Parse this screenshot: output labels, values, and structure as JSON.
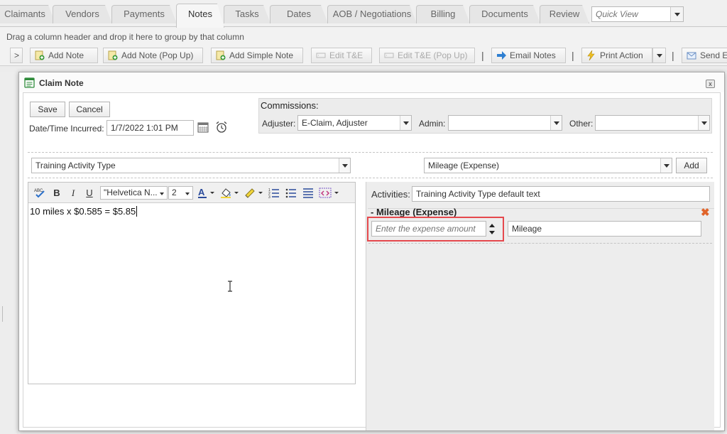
{
  "tabs": [
    {
      "label": "Claimants",
      "active": false
    },
    {
      "label": "Vendors",
      "active": false
    },
    {
      "label": "Payments",
      "active": false
    },
    {
      "label": "Notes",
      "active": true
    },
    {
      "label": "Tasks",
      "active": false
    },
    {
      "label": "Dates",
      "active": false
    },
    {
      "label": "AOB / Negotiations",
      "active": false
    },
    {
      "label": "Billing",
      "active": false
    },
    {
      "label": "Documents",
      "active": false
    },
    {
      "label": "Review",
      "active": false
    }
  ],
  "quick_view": {
    "placeholder": "Quick View"
  },
  "group_hint": "Drag a column header and drop it here to group by that column",
  "toolbar": {
    "expand": ">",
    "add_note": "Add Note",
    "add_note_popup": "Add Note (Pop Up)",
    "add_simple_note": "Add Simple Note",
    "edit_te": "Edit T&E",
    "edit_te_popup": "Edit T&E (Pop Up)",
    "separator": "|",
    "email_notes": "Email Notes",
    "print_action": "Print Action",
    "send_email": "Send E"
  },
  "modal": {
    "title": "Claim Note",
    "close": "x",
    "save": "Save",
    "cancel": "Cancel",
    "datetime_label": "Date/Time Incurred:",
    "datetime_value": "1/7/2022 1:01 PM",
    "commissions": {
      "title": "Commissions:",
      "adjuster_label": "Adjuster:",
      "adjuster_value": "E-Claim, Adjuster",
      "admin_label": "Admin:",
      "admin_value": "",
      "other_label": "Other:",
      "other_value": ""
    },
    "activity_type": "Training Activity Type",
    "expense_type": "Mileage (Expense)",
    "add_button": "Add",
    "editor": {
      "font_name": "\"Helvetica N...",
      "font_size": "2",
      "bold": "B",
      "italic": "I",
      "underline": "U",
      "content": "10 miles x $0.585 = $5.85"
    },
    "activities": {
      "label": "Activities:",
      "value": "Training Activity Type default text",
      "expense_title": "- Mileage (Expense)",
      "amount_placeholder": "Enter the expense amount",
      "description": "Mileage",
      "remove_icon": "✖"
    }
  }
}
